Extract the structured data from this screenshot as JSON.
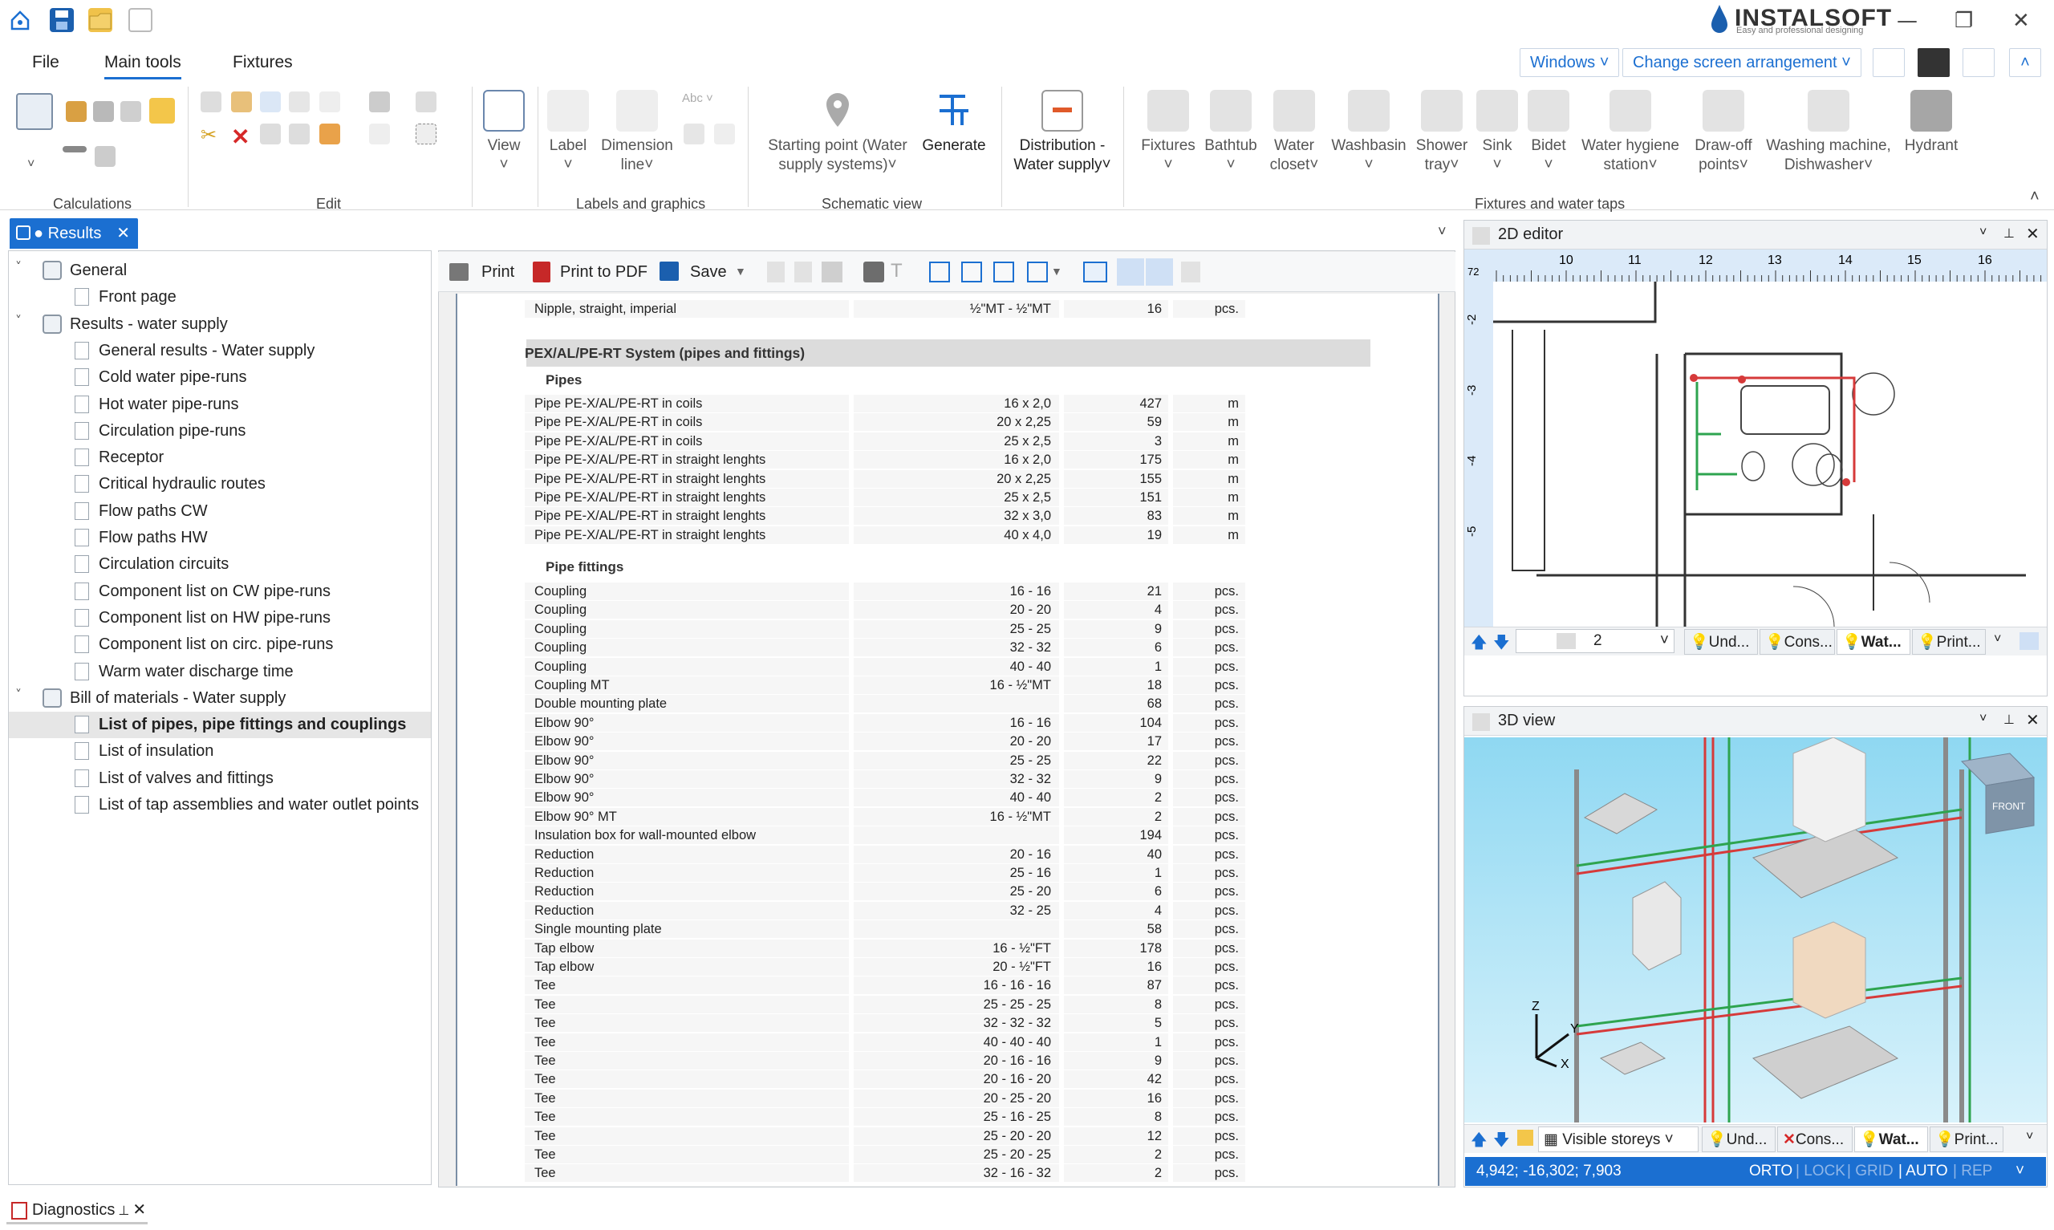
{
  "app": {
    "brand": "INSTALSOFT",
    "brand_tagline": "Easy and professional designing"
  },
  "menu": {
    "file": "File",
    "main_tools": "Main tools",
    "fixtures": "Fixtures"
  },
  "top_buttons": {
    "windows": "Windows",
    "arrangement": "Change screen arrangement"
  },
  "ribbon": {
    "groups": {
      "calculations": "Calculations",
      "edit": "Edit",
      "labels": "Labels and graphics",
      "schematic": "Schematic view",
      "fixtures": "Fixtures and water taps"
    },
    "view": "View",
    "label": "Label",
    "dimension_line": [
      "Dimension",
      "line"
    ],
    "starting_point": [
      "Starting point (Water",
      "supply systems)"
    ],
    "generate": "Generate",
    "distribution": [
      "Distribution -",
      "Water supply"
    ],
    "fixtures": "Fixtures",
    "bathtub": "Bathtub",
    "water_closet": [
      "Water",
      "closet"
    ],
    "washbasin": "Washbasin",
    "shower_tray": [
      "Shower",
      "tray"
    ],
    "sink": "Sink",
    "bidet": "Bidet",
    "water_hygiene": [
      "Water hygiene",
      "station"
    ],
    "draw_off": [
      "Draw-off",
      "points"
    ],
    "washing_machine": [
      "Washing machine,",
      "Dishwasher"
    ],
    "hydrant": "Hydrant"
  },
  "results_tab": "Results",
  "tree": [
    {
      "label": "General",
      "level": 0,
      "type": "group"
    },
    {
      "label": "Front page",
      "level": 1,
      "type": "doc"
    },
    {
      "label": "Results - water supply",
      "level": 0,
      "type": "group"
    },
    {
      "label": "General results - Water supply",
      "level": 1,
      "type": "doc"
    },
    {
      "label": "Cold water pipe-runs",
      "level": 1,
      "type": "doc"
    },
    {
      "label": "Hot water pipe-runs",
      "level": 1,
      "type": "doc"
    },
    {
      "label": "Circulation pipe-runs",
      "level": 1,
      "type": "doc"
    },
    {
      "label": "Receptor",
      "level": 1,
      "type": "doc"
    },
    {
      "label": "Critical hydraulic routes",
      "level": 1,
      "type": "doc"
    },
    {
      "label": "Flow paths CW",
      "level": 1,
      "type": "doc"
    },
    {
      "label": "Flow paths HW",
      "level": 1,
      "type": "doc"
    },
    {
      "label": "Circulation circuits",
      "level": 1,
      "type": "doc"
    },
    {
      "label": "Component list on CW pipe-runs",
      "level": 1,
      "type": "doc"
    },
    {
      "label": "Component list on HW pipe-runs",
      "level": 1,
      "type": "doc"
    },
    {
      "label": "Component list on circ. pipe-runs",
      "level": 1,
      "type": "doc"
    },
    {
      "label": "Warm water discharge time",
      "level": 1,
      "type": "doc"
    },
    {
      "label": "Bill of materials - Water supply",
      "level": 0,
      "type": "group"
    },
    {
      "label": "List of pipes, pipe fittings and couplings",
      "level": 1,
      "type": "doc",
      "selected": true
    },
    {
      "label": "List of insulation",
      "level": 1,
      "type": "doc"
    },
    {
      "label": "List of valves and fittings",
      "level": 1,
      "type": "doc"
    },
    {
      "label": "List of tap assemblies and water outlet points",
      "level": 1,
      "type": "doc"
    }
  ],
  "report_toolbar": {
    "print": "Print",
    "print_pdf": "Print to PDF",
    "save": "Save"
  },
  "report": {
    "top_row": {
      "name": "Nipple, straight, imperial",
      "size": "½\"MT - ½\"MT",
      "qty": "16",
      "unit": "pcs."
    },
    "section": "PEX/AL/PE-RT System (pipes and fittings)",
    "pipes_title": "Pipes",
    "pipes": [
      {
        "name": "Pipe PE-X/AL/PE-RT in coils",
        "size": "16 x 2,0",
        "qty": "427",
        "unit": "m"
      },
      {
        "name": "Pipe PE-X/AL/PE-RT in coils",
        "size": "20 x 2,25",
        "qty": "59",
        "unit": "m"
      },
      {
        "name": "Pipe PE-X/AL/PE-RT in coils",
        "size": "25 x 2,5",
        "qty": "3",
        "unit": "m"
      },
      {
        "name": "Pipe PE-X/AL/PE-RT in straight lenghts",
        "size": "16 x 2,0",
        "qty": "175",
        "unit": "m"
      },
      {
        "name": "Pipe PE-X/AL/PE-RT in straight lenghts",
        "size": "20 x 2,25",
        "qty": "155",
        "unit": "m"
      },
      {
        "name": "Pipe PE-X/AL/PE-RT in straight lenghts",
        "size": "25 x 2,5",
        "qty": "151",
        "unit": "m"
      },
      {
        "name": "Pipe PE-X/AL/PE-RT in straight lenghts",
        "size": "32 x 3,0",
        "qty": "83",
        "unit": "m"
      },
      {
        "name": "Pipe PE-X/AL/PE-RT in straight lenghts",
        "size": "40 x 4,0",
        "qty": "19",
        "unit": "m"
      }
    ],
    "fittings_title": "Pipe fittings",
    "fittings": [
      {
        "name": "Coupling",
        "size": "16 - 16",
        "qty": "21",
        "unit": "pcs."
      },
      {
        "name": "Coupling",
        "size": "20 - 20",
        "qty": "4",
        "unit": "pcs."
      },
      {
        "name": "Coupling",
        "size": "25 - 25",
        "qty": "9",
        "unit": "pcs."
      },
      {
        "name": "Coupling",
        "size": "32 - 32",
        "qty": "6",
        "unit": "pcs."
      },
      {
        "name": "Coupling",
        "size": "40 - 40",
        "qty": "1",
        "unit": "pcs."
      },
      {
        "name": "Coupling MT",
        "size": "16 - ½\"MT",
        "qty": "18",
        "unit": "pcs."
      },
      {
        "name": "Double mounting plate",
        "size": "",
        "qty": "68",
        "unit": "pcs."
      },
      {
        "name": "Elbow 90°",
        "size": "16 - 16",
        "qty": "104",
        "unit": "pcs."
      },
      {
        "name": "Elbow 90°",
        "size": "20 - 20",
        "qty": "17",
        "unit": "pcs."
      },
      {
        "name": "Elbow 90°",
        "size": "25 - 25",
        "qty": "22",
        "unit": "pcs."
      },
      {
        "name": "Elbow 90°",
        "size": "32 - 32",
        "qty": "9",
        "unit": "pcs."
      },
      {
        "name": "Elbow 90°",
        "size": "40 - 40",
        "qty": "2",
        "unit": "pcs."
      },
      {
        "name": "Elbow 90° MT",
        "size": "16 - ½\"MT",
        "qty": "2",
        "unit": "pcs."
      },
      {
        "name": "Insulation box for wall-mounted elbow",
        "size": "",
        "qty": "194",
        "unit": "pcs."
      },
      {
        "name": "Reduction",
        "size": "20 - 16",
        "qty": "40",
        "unit": "pcs."
      },
      {
        "name": "Reduction",
        "size": "25 - 16",
        "qty": "1",
        "unit": "pcs."
      },
      {
        "name": "Reduction",
        "size": "25 - 20",
        "qty": "6",
        "unit": "pcs."
      },
      {
        "name": "Reduction",
        "size": "32 - 25",
        "qty": "4",
        "unit": "pcs."
      },
      {
        "name": "Single mounting plate",
        "size": "",
        "qty": "58",
        "unit": "pcs."
      },
      {
        "name": "Tap elbow",
        "size": "16 - ½\"FT",
        "qty": "178",
        "unit": "pcs."
      },
      {
        "name": "Tap elbow",
        "size": "20 - ½\"FT",
        "qty": "16",
        "unit": "pcs."
      },
      {
        "name": "Tee",
        "size": "16 - 16 - 16",
        "qty": "87",
        "unit": "pcs."
      },
      {
        "name": "Tee",
        "size": "25 - 25 - 25",
        "qty": "8",
        "unit": "pcs."
      },
      {
        "name": "Tee",
        "size": "32 - 32 - 32",
        "qty": "5",
        "unit": "pcs."
      },
      {
        "name": "Tee",
        "size": "40 - 40 - 40",
        "qty": "1",
        "unit": "pcs."
      },
      {
        "name": "Tee",
        "size": "20 - 16 - 16",
        "qty": "9",
        "unit": "pcs."
      },
      {
        "name": "Tee",
        "size": "20 - 16 - 20",
        "qty": "42",
        "unit": "pcs."
      },
      {
        "name": "Tee",
        "size": "20 - 25 - 20",
        "qty": "16",
        "unit": "pcs."
      },
      {
        "name": "Tee",
        "size": "25 - 16 - 25",
        "qty": "8",
        "unit": "pcs."
      },
      {
        "name": "Tee",
        "size": "25 - 20 - 20",
        "qty": "12",
        "unit": "pcs."
      },
      {
        "name": "Tee",
        "size": "25 - 20 - 25",
        "qty": "2",
        "unit": "pcs."
      },
      {
        "name": "Tee",
        "size": "32 - 16 - 32",
        "qty": "2",
        "unit": "pcs."
      }
    ]
  },
  "editor2d": {
    "title": "2D editor",
    "ruler": [
      "10",
      "11",
      "12",
      "13",
      "14",
      "15",
      "16"
    ],
    "vruler": [
      "-2",
      "-3",
      "-4",
      "-5"
    ],
    "ruler_corner": "72",
    "storey": "2",
    "tabs": [
      "Und...",
      "Cons...",
      "Wat...",
      "Print..."
    ]
  },
  "view3d": {
    "title": "3D view",
    "front": "FRONT",
    "axes": {
      "z": "Z",
      "y": "Y",
      "x": "X"
    },
    "storeys": "Visible storeys",
    "tabs": [
      "Und...",
      "Cons...",
      "Wat...",
      "Print..."
    ]
  },
  "status": {
    "coords": "4,942; -16,302; 7,903",
    "orto": "ORTO",
    "lock": "LOCK",
    "grid": "GRID",
    "auto": "AUTO",
    "rep": "REP"
  },
  "diagnostics": "Diagnostics",
  "colors": {
    "accent": "#1b6fd1",
    "brand": "#1b5fae",
    "pipe_red": "#d63a3a",
    "pipe_green": "#2ea44f"
  }
}
